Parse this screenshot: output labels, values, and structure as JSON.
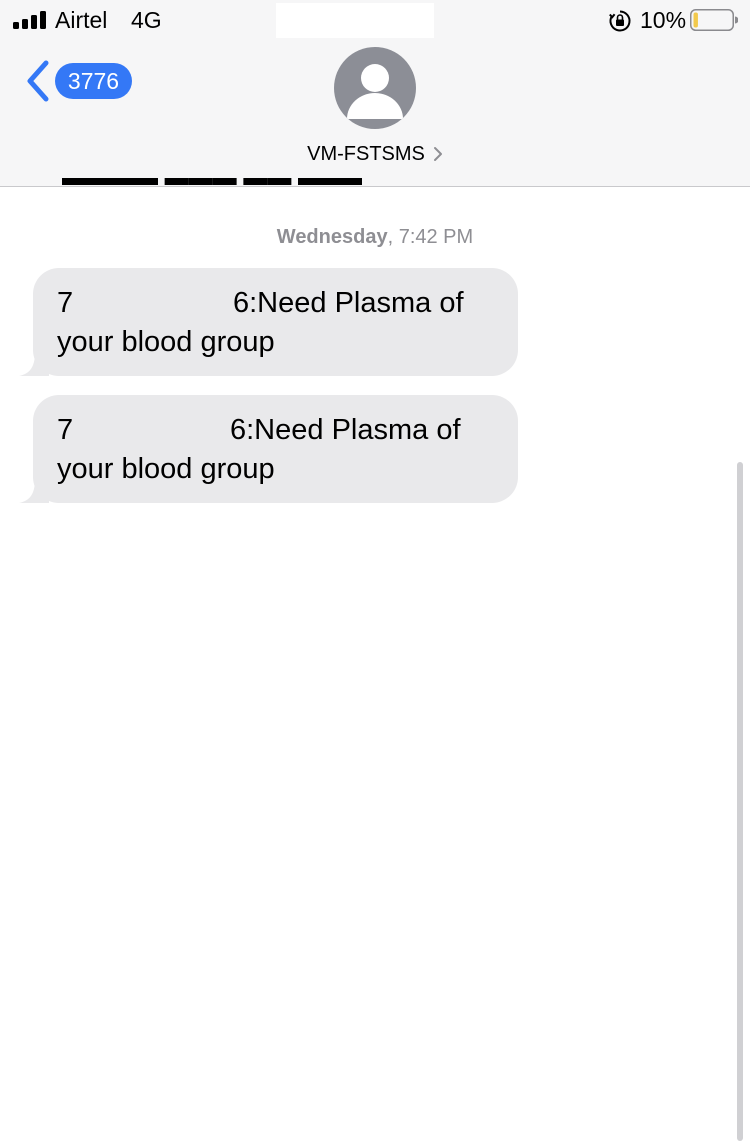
{
  "status_bar": {
    "carrier": "Airtel",
    "network": "4G",
    "battery_percent": "10%",
    "battery_level": 0.1
  },
  "nav": {
    "unread_count": "3776",
    "contact_name": "VM-FSTSMS"
  },
  "thread": {
    "timestamp_day": "Wednesday",
    "timestamp_time": ", 7:42 PM",
    "messages": [
      {
        "line1_start": "7",
        "line1_end": "6:Need Plasma of",
        "line2": "your blood group"
      },
      {
        "line1_start": "7",
        "line1_end": "6:Need Plasma of",
        "line2": "your blood group"
      }
    ]
  },
  "colors": {
    "accent": "#3478f6",
    "bubble": "#e9e9eb",
    "timestamp": "#8e8e93",
    "battery_fill": "#f2c94c"
  },
  "icons": [
    "signal-icon",
    "rotation-lock-icon",
    "battery-icon",
    "back-chevron-icon",
    "contact-avatar-icon",
    "chevron-right-icon"
  ]
}
